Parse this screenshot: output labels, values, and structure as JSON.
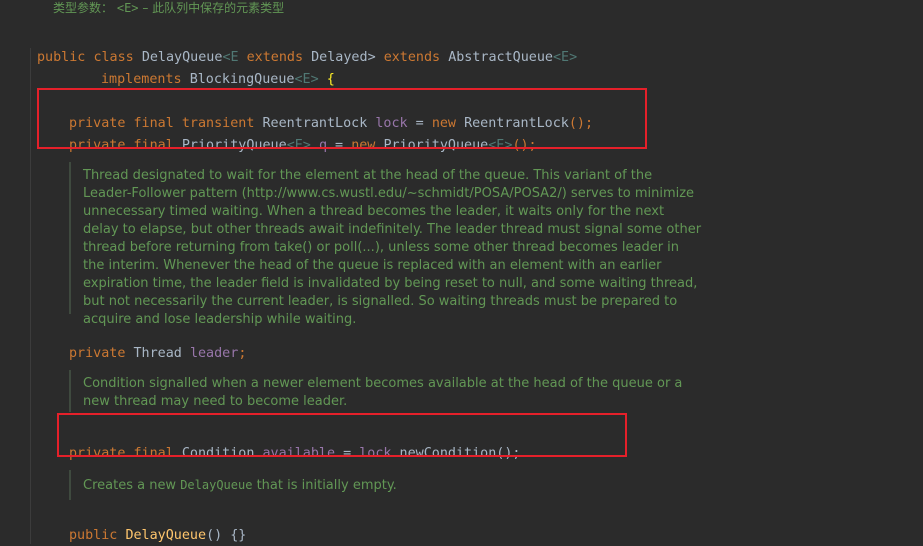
{
  "top_doc": {
    "label": "类型参数：",
    "param": "<E>",
    "text": " – 此队列中保存的元素类型"
  },
  "class_decl": {
    "kw_public": "public",
    "kw_class": "class",
    "name": "DelayQueue",
    "generic": "<E",
    "kw_extends": "extends",
    "bound": "Delayed",
    "close": ">",
    "kw_extends2": "extends",
    "super": "AbstractQueue",
    "super_generic": "<E>",
    "kw_implements": "implements",
    "iface": "BlockingQueue",
    "iface_generic": "<E>",
    "brace": "{"
  },
  "field_lock": {
    "kw1": "private",
    "kw2": "final",
    "kw3": "transient",
    "type": "ReentrantLock",
    "name": "lock",
    "eq": " = ",
    "kw_new": "new",
    "ctor": "ReentrantLock",
    "tail": "();"
  },
  "field_q": {
    "kw1": "private",
    "kw2": "final",
    "type": "PriorityQueue",
    "generic": "<E>",
    "name": "q",
    "eq": " = ",
    "kw_new": "new",
    "ctor": "PriorityQueue",
    "ctor_generic": "<E>",
    "tail": "();"
  },
  "doc_leader": {
    "text": "Thread designated to wait for the element at the head of the queue. This variant of the Leader-Follower pattern (http://www.cs.wustl.edu/~schmidt/POSA/POSA2/) serves to minimize unnecessary timed waiting. When a thread becomes the leader, it waits only for the next delay to elapse, but other threads await indefinitely. The leader thread must signal some other thread before returning from take() or poll(...), unless some other thread becomes leader in the interim. Whenever the head of the queue is replaced with an element with an earlier expiration time, the leader field is invalidated by being reset to null, and some waiting thread, but not necessarily the current leader, is signalled. So waiting threads must be prepared to acquire and lose leadership while waiting."
  },
  "field_leader": {
    "kw1": "private",
    "type": "Thread",
    "name": "leader",
    "tail": ";"
  },
  "doc_available": {
    "text": "Condition signalled when a newer element becomes available at the head of the queue or a new thread may need to become leader."
  },
  "field_available": {
    "kw1": "private",
    "kw2": "final",
    "type": "Condition",
    "name": "available",
    "eq": " = ",
    "ref": "lock",
    "call": ".newCondition();"
  },
  "doc_ctor": {
    "pre": "Creates a new ",
    "code": "DelayQueue",
    "post": " that is initially empty."
  },
  "ctor": {
    "kw": "public",
    "name": "DelayQueue",
    "tail": "() {}"
  },
  "colors": {
    "background": "#2b2b2b",
    "keyword": "#cc7832",
    "field": "#9876aa",
    "method": "#ffc66d",
    "doc": "#629755",
    "highlight_box": "#e5202a"
  }
}
